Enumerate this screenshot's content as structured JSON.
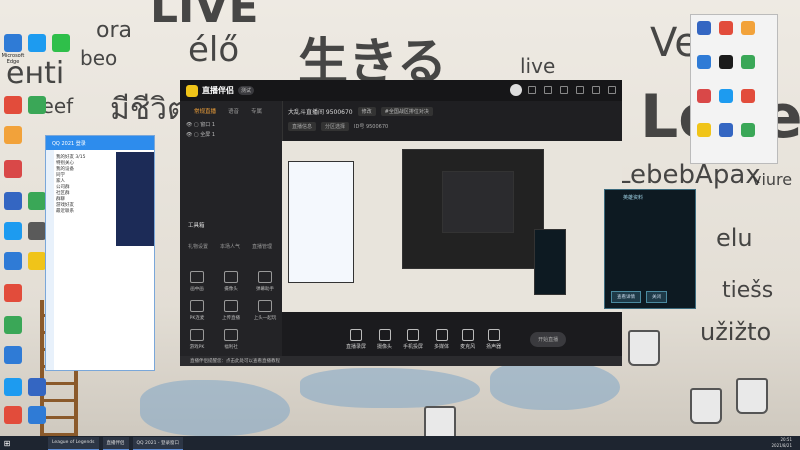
{
  "app": {
    "name": "直播伴侣",
    "badge": "测试",
    "left_tabs": [
      "常规直播",
      "语音",
      "专属"
    ],
    "scenes": [
      {
        "label": "窗口 1"
      },
      {
        "label": "全屏 1"
      }
    ],
    "tools_section_title": "工具箱",
    "tools_top": [
      "礼物设置",
      "本场人气",
      "直播管理"
    ],
    "tools": [
      "画中画",
      "摄像头",
      "弹幕助手",
      "PK连麦",
      "上传直播",
      "上头一起玩",
      "游戏PK",
      "福利社"
    ],
    "room_title": "大乱斗直播间 9500670",
    "room_pill": "修改",
    "room_extra": "#全国战区排位对决",
    "room_row2": [
      "直播信息",
      "分区选择",
      "ID号 9500670"
    ],
    "bottom_buttons": [
      "直播录屏",
      "摄像头",
      "手机投屏",
      "多媒体",
      "麦克风",
      "扬声器"
    ],
    "start_label": "开始直播",
    "notice": "直播伴侣提醒您：点击此处可以查看直播教程"
  },
  "popup": {
    "title": "英雄资料",
    "buttons": [
      "查看详情",
      "关闭"
    ]
  },
  "qq": {
    "title": "QQ 2021 登录",
    "items": [
      "我的好友 3/15",
      "特别关心",
      "我的设备",
      "同学",
      "家人",
      "公司群",
      "社区群",
      "群聊",
      "游戏好友",
      "最近联系"
    ]
  },
  "desktop_icons": [
    "Microsoft Edge",
    "QQ",
    "WeChat",
    "Steam",
    "腾讯会议",
    "Chrome"
  ],
  "taskbar": {
    "tasks": [
      "League of Legends",
      "直播伴侣",
      "QQ 2021 - 登录窗口"
    ],
    "time": "20:51",
    "date": "2021/8/21"
  },
  "wall_text": [
    "LIVE",
    "ora",
    "élő",
    "生きる",
    "live",
    "Vel'a",
    "Lebe",
    "beo",
    "енti",
    "leef",
    "มีชีวิต",
    "LebebApax",
    "viure",
    "elu",
    "tiešs",
    "užižto"
  ]
}
